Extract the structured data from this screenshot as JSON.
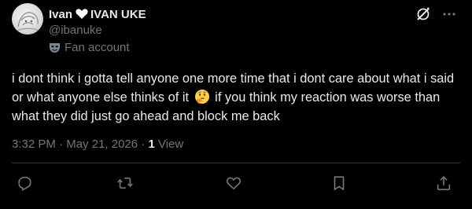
{
  "author": {
    "display_name_first": "Ivan",
    "heart_emoji": "white-heart-icon",
    "display_name_second": "IVAN UKE",
    "handle": "@ibanuke",
    "label": "Fan account",
    "label_icon": "mask-icon"
  },
  "tweet": {
    "text_part1": "i dont think i gotta tell anyone one more time that i dont care about what i said or what anyone else thinks of it",
    "emoji": "thinking-face",
    "text_part2": "if you think my reaction was worse than what they did just go ahead and block me back"
  },
  "meta": {
    "time": "3:32 PM",
    "separator": " · ",
    "date": "May 21, 2026",
    "separator2": " · ",
    "views_count": "1",
    "views_label": " View"
  },
  "actions": [
    "reply-icon",
    "retweet-icon",
    "like-icon",
    "bookmark-icon",
    "share-icon"
  ],
  "colors": {
    "background": "#000000",
    "text_primary": "#e7e9ea",
    "text_secondary": "#71767b",
    "divider": "#2f3336"
  }
}
